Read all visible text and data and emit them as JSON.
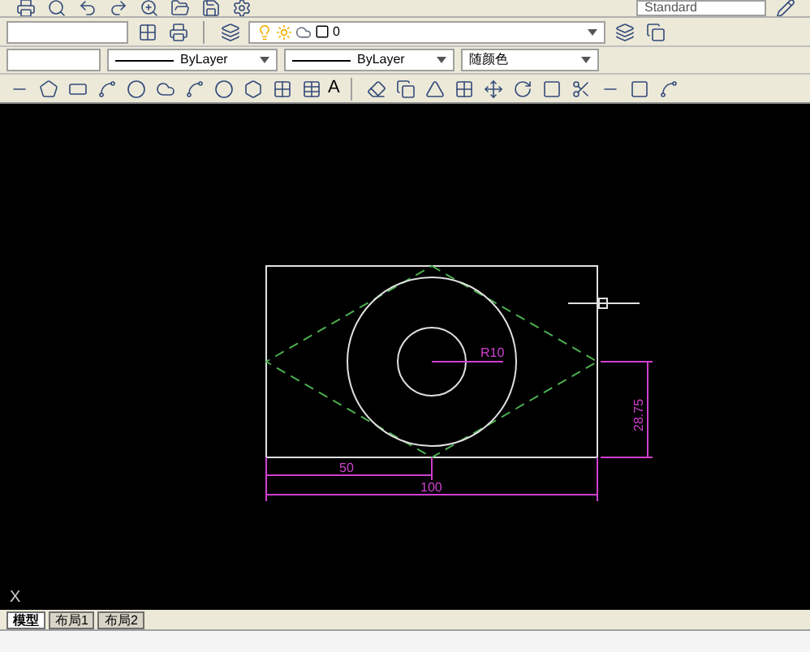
{
  "toolbar_top": {
    "text_style": "Standard"
  },
  "layer_bar": {
    "layer_name": "0"
  },
  "properties_bar": {
    "linetype": "ByLayer",
    "lineweight": "ByLayer",
    "plot_style": "随颜色"
  },
  "draw_toolbar": {
    "text_tool": "A"
  },
  "drawing": {
    "radius_label": "R10",
    "half_width_label": "50",
    "width_label": "100",
    "height_label": "28.75"
  },
  "ucs": {
    "axis_label": "X"
  },
  "layout_tabs": [
    {
      "label": "模型",
      "selected": true
    },
    {
      "label": "布局1",
      "selected": false
    },
    {
      "label": "布局2",
      "selected": false
    }
  ]
}
